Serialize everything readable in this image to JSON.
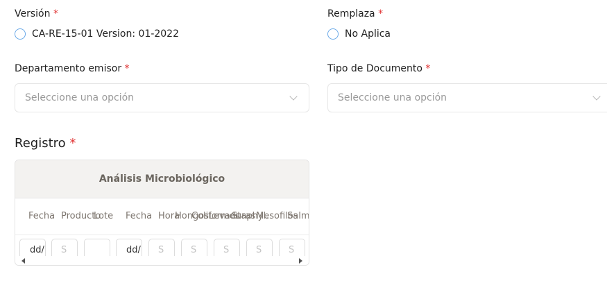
{
  "version": {
    "label": "Versión",
    "required_mark": "*",
    "option": "CA-RE-15-01 Version: 01-2022"
  },
  "remplaza": {
    "label": "Remplaza",
    "required_mark": "*",
    "option": "No Aplica"
  },
  "departamento": {
    "label": "Departamento emisor",
    "required_mark": "*",
    "placeholder": "Seleccione una opción"
  },
  "tipo_documento": {
    "label": "Tipo de Documento",
    "required_mark": "*",
    "placeholder": "Seleccione una opción"
  },
  "registro": {
    "title": "Registro",
    "required_mark": "*",
    "table": {
      "header": "Análisis Microbiológico",
      "columns": [
        "Fecha",
        "Producto",
        "Lote",
        "Fecha",
        "Hora",
        "Hongos",
        "Coliformes",
        "Levaduras",
        "Staphyl.",
        "Mesofilos",
        "Salmonella"
      ],
      "inputs": [
        "dd/",
        "S",
        "",
        "dd/",
        "S",
        "S",
        "S",
        "S",
        "S"
      ]
    }
  }
}
